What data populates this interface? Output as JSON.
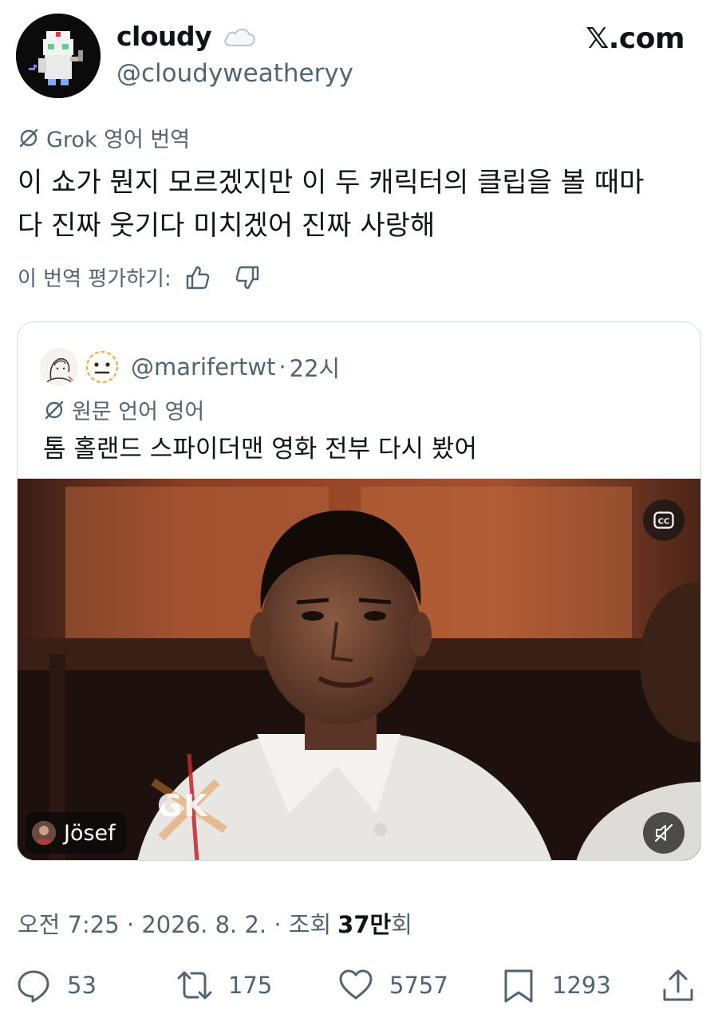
{
  "author": {
    "display_name": "cloudy",
    "handle": "@cloudyweatheryy"
  },
  "brand": "𝕏.com",
  "translation": {
    "label": "Grok 영어 번역",
    "text_line1": "이 쇼가 뭔지 모르겠지만 이 두 캐릭터의 클립을 볼 때마",
    "text_line2": "다 진짜 웃기다 미치겠어 진짜 사랑해",
    "rate_label": "이 번역 평가하기:"
  },
  "quote": {
    "handle": "@marifertwt",
    "separator": "·",
    "time": "22시",
    "lang_label": "원문 언어 영어",
    "text": "톰 홀랜드 스파이더맨 영화 전부 다시 봤어",
    "video": {
      "credit_name": "Jösef",
      "watermark": "GK",
      "muted": true
    }
  },
  "meta": {
    "time_date": "오전 7:25 · 2026. 8. 2. · 조회",
    "views": "37만",
    "views_suffix": "회"
  },
  "actions": {
    "replies": "53",
    "retweets": "175",
    "likes": "5757",
    "bookmarks": "1293"
  },
  "icons": [
    "cloud-icon",
    "translate-icon",
    "thumb-up-icon",
    "thumb-down-icon",
    "cc-icon",
    "mute-icon",
    "reply-icon",
    "retweet-icon",
    "like-icon",
    "bookmark-icon",
    "share-icon"
  ],
  "colors": {
    "text_primary": "#0f1419",
    "text_secondary": "#536471",
    "border": "#cfd9de"
  }
}
